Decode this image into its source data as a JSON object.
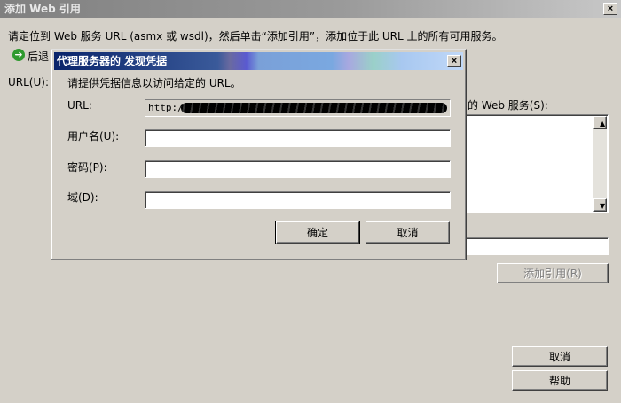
{
  "main_window": {
    "title": "添加 Web 引用",
    "close_glyph": "×",
    "instruction": "请定位到 Web 服务 URL (asmx 或 wsdl)，然后单击“添加引用”，添加位于此 URL 上的所有可用服务。",
    "back_label": "后退",
    "back_icon": "back-arrow-icon",
    "url_label": "URL(U):",
    "services_label_partial": "的 Web 服务(S):",
    "add_reference_button": "添加引用(R)",
    "cancel_button": "取消",
    "help_button": "帮助",
    "scroll_up_glyph": "▲",
    "scroll_down_glyph": "▼"
  },
  "dialog": {
    "title": "代理服务器的 发现凭据",
    "close_glyph": "×",
    "prompt": "请提供凭据信息以访问给定的 URL。",
    "url_label": "URL:",
    "url_value": "http://",
    "username_label": "用户名(U):",
    "password_label": "密码(P):",
    "domain_label": "域(D):",
    "username_value": "",
    "password_value": "",
    "domain_value": "",
    "ok_button": "确定",
    "cancel_button": "取消"
  },
  "colors": {
    "face": "#d4d0c8",
    "active_title_start": "#0a246a",
    "inactive_title": "#808080"
  }
}
